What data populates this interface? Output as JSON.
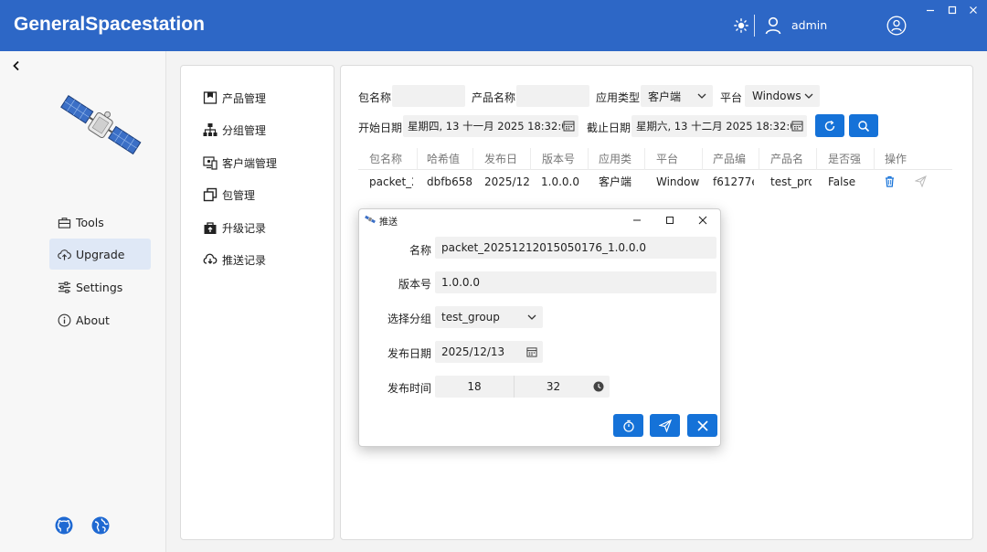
{
  "app": {
    "title": "GeneralSpacestation",
    "user": "admin"
  },
  "nav": {
    "items": [
      {
        "label": "Tools",
        "icon": "toolbox-icon"
      },
      {
        "label": "Upgrade",
        "icon": "cloud-upload-icon",
        "active": true
      },
      {
        "label": "Settings",
        "icon": "sliders-icon"
      },
      {
        "label": "About",
        "icon": "info-icon"
      }
    ]
  },
  "menu": {
    "items": [
      {
        "label": "产品管理",
        "icon": "product-icon"
      },
      {
        "label": "分组管理",
        "icon": "group-icon"
      },
      {
        "label": "客户端管理",
        "icon": "client-icon"
      },
      {
        "label": "包管理",
        "icon": "package-icon"
      },
      {
        "label": "升级记录",
        "icon": "upgrade-record-icon"
      },
      {
        "label": "推送记录",
        "icon": "push-record-icon"
      }
    ]
  },
  "filters": {
    "package_name_label": "包名称",
    "package_name_value": "",
    "product_name_label": "产品名称",
    "product_name_value": "",
    "app_type_label": "应用类型",
    "app_type_value": "客户端",
    "platform_label": "平台",
    "platform_value": "Windows",
    "start_date_label": "开始日期",
    "start_date_value": "星期四, 13 十一月 2025 18:32:0",
    "end_date_label": "截止日期",
    "end_date_value": "星期六, 13 十二月 2025 18:32:0"
  },
  "table": {
    "columns": [
      "包名称",
      "哈希值",
      "发布日",
      "版本号",
      "应用类",
      "平台",
      "产品编",
      "产品名",
      "是否强",
      "操作"
    ],
    "rows": [
      [
        "packet_2",
        "dbfb658",
        "2025/12",
        "1.0.0.0",
        "客户端",
        "Window",
        "f61277e",
        "test_pro",
        "False"
      ]
    ]
  },
  "dialog": {
    "title": "推送",
    "name_label": "名称",
    "name_value": "packet_20251212015050176_1.0.0.0",
    "version_label": "版本号",
    "version_value": "1.0.0.0",
    "group_label": "选择分组",
    "group_value": "test_group",
    "date_label": "发布日期",
    "date_value": "2025/12/13",
    "time_label": "发布时间",
    "hour_value": "18",
    "minute_value": "32"
  },
  "colors": {
    "titlebar": "#2d67c6",
    "accent": "#1572d8",
    "nav_active": "#dfe8f6"
  }
}
